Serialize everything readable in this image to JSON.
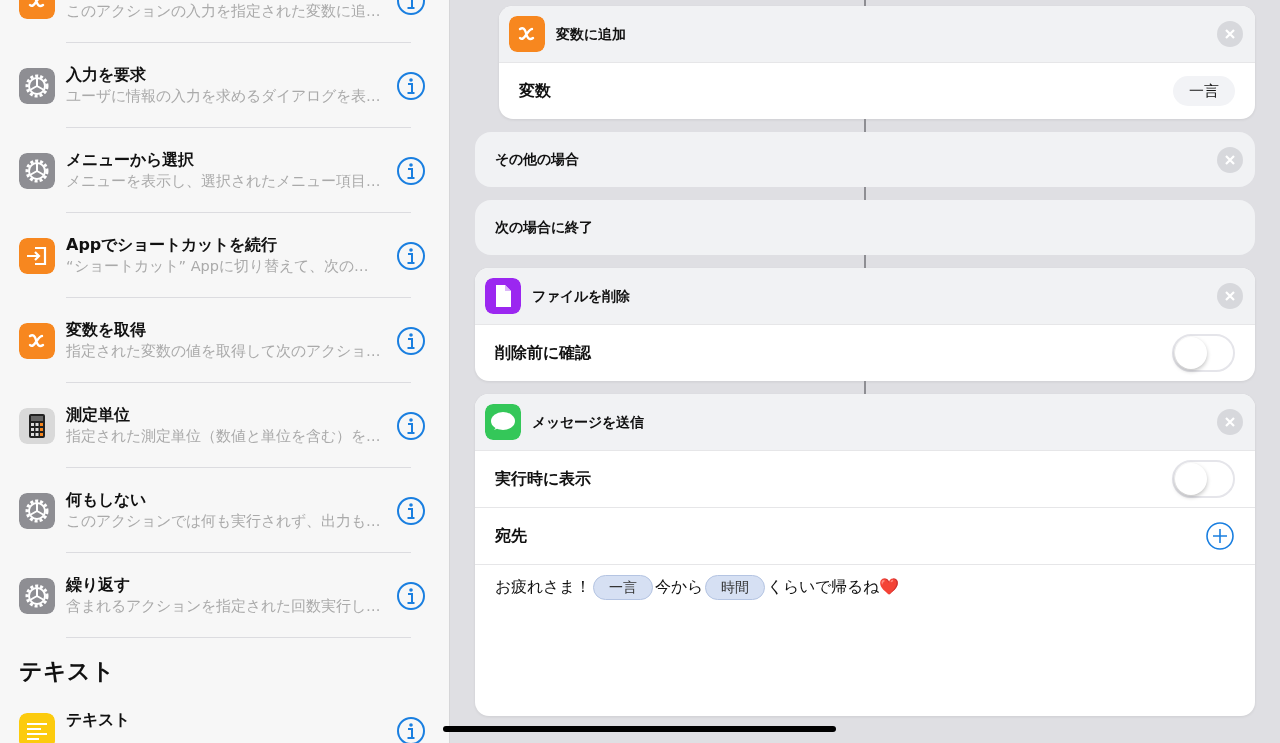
{
  "action_list": {
    "items": [
      {
        "kind": "variable",
        "subtitle": "このアクションの入力を指定された変数に追…"
      },
      {
        "kind": "gear",
        "title": "入力を要求",
        "subtitle": "ユーザに情報の入力を求めるダイアログを表…"
      },
      {
        "kind": "gear",
        "title": "メニューから選択",
        "subtitle": "メニューを表示し、選択されたメニュー項目…"
      },
      {
        "kind": "app",
        "title": "Appでショートカットを続行",
        "subtitle": "“ショートカット” Appに切り替えて、次の…"
      },
      {
        "kind": "variable",
        "title": "変数を取得",
        "subtitle": "指定された変数の値を取得して次のアクショ…"
      },
      {
        "kind": "calculator",
        "title": "測定単位",
        "subtitle": "指定された測定単位（数値と単位を含む）を…"
      },
      {
        "kind": "gear",
        "title": "何もしない",
        "subtitle": "このアクションでは何も実行されず、出力も…"
      },
      {
        "kind": "gear",
        "title": "繰り返す",
        "subtitle": "含まれるアクションを指定された回数実行し…"
      }
    ],
    "section": {
      "title": "テキスト",
      "items": [
        {
          "kind": "text",
          "title": "テキスト"
        }
      ]
    }
  },
  "workflow": {
    "actions": [
      {
        "kind": "variable",
        "indented": true,
        "title": "変数に追加",
        "removable": true,
        "rows": [
          {
            "kind": "value",
            "label": "変数",
            "value": "一言"
          }
        ]
      },
      {
        "kind": "control",
        "title": "その他の場合",
        "removable": true
      },
      {
        "kind": "control",
        "title": "次の場合に終了",
        "removable": false
      },
      {
        "kind": "file",
        "indented": false,
        "title": "ファイルを削除",
        "removable": true,
        "rows": [
          {
            "kind": "toggle",
            "label": "削除前に確認",
            "on": false
          }
        ]
      },
      {
        "kind": "messages",
        "indented": false,
        "title": "メッセージを送信",
        "removable": true,
        "rows": [
          {
            "kind": "toggle",
            "label": "実行時に表示",
            "on": false
          },
          {
            "kind": "add",
            "label": "宛先"
          },
          {
            "kind": "message",
            "parts": [
              {
                "kind": "text",
                "text": "お疲れさま！"
              },
              {
                "kind": "token",
                "text": "一言"
              },
              {
                "kind": "text",
                "text": "今から"
              },
              {
                "kind": "token",
                "text": "時間"
              },
              {
                "kind": "text",
                "text": "くらいで帰るね❤️"
              }
            ]
          }
        ]
      }
    ]
  }
}
